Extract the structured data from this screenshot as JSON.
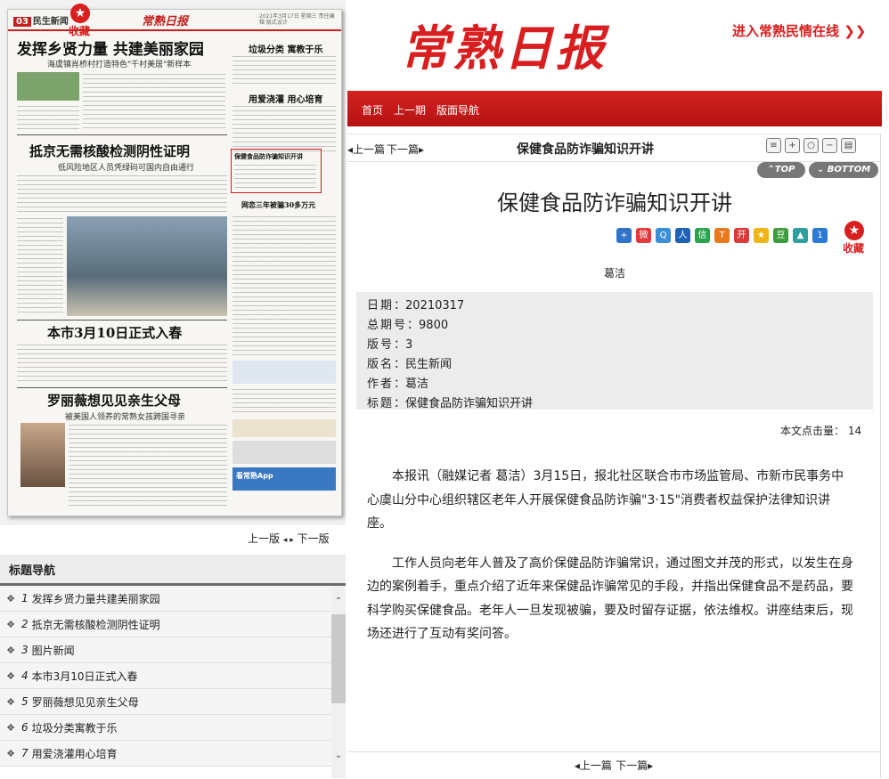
{
  "paper": {
    "section_no": "03",
    "section_name": "民生新闻",
    "logo": "常熟日报",
    "date_line": "2021年3月17日 星期三 责任编辑 版式设计",
    "favorite_label": "收藏",
    "headlines": {
      "h1": "发挥乡贤力量 共建美丽家园",
      "h1_sub": "海虞镇肖桥村打造特色\"千村美居\"新样本",
      "h2": "抵京无需核酸检测阴性证明",
      "h2_sub": "低风险地区人员凭绿码可国内自由通行",
      "h3": "本市3月10日正式入春",
      "h4": "罗丽薇想见见亲生父母",
      "h4_sub": "被美国人领养的常熟女孩跨国寻亲",
      "r1": "垃圾分类 寓教于乐",
      "r2": "用爱浇灌 用心培育",
      "r3": "保健食品防诈骗知识开讲",
      "r4": "网恋三年被骗30多万元",
      "r5": "看常熟App"
    }
  },
  "page_nav": {
    "prev": "上一版",
    "next": "下一版"
  },
  "title_nav": {
    "header": "标题导航",
    "items": [
      {
        "num": "1",
        "label": "发挥乡贤力量共建美丽家园"
      },
      {
        "num": "2",
        "label": "抵京无需核酸检测阴性证明"
      },
      {
        "num": "3",
        "label": "图片新闻"
      },
      {
        "num": "4",
        "label": "本市3月10日正式入春"
      },
      {
        "num": "5",
        "label": "罗丽薇想见见亲生父母"
      },
      {
        "num": "6",
        "label": "垃圾分类寓教于乐"
      },
      {
        "num": "7",
        "label": "用爱浇灌用心培育"
      }
    ]
  },
  "masthead": {
    "logo": "常熟日报",
    "link": "进入常熟民情在线 ❯❯"
  },
  "nav": {
    "home": "首页",
    "prev_issue": "上一期",
    "layout_nav": "版面导航"
  },
  "toolbar": {
    "prev": "◂上一篇",
    "next": "下一篇▸",
    "title": "保健食品防诈骗知识开讲",
    "top": "⌃TOP",
    "bottom": "⌄ BOTTOM"
  },
  "article": {
    "title": "保健食品防诈骗知识开讲",
    "author": "葛洁",
    "favorite_label": "收藏",
    "meta": [
      {
        "key": "日期",
        "value": "20210317"
      },
      {
        "key": "总期号",
        "value": "9800"
      },
      {
        "key": "版号",
        "value": "3"
      },
      {
        "key": "版名",
        "value": "民生新闻"
      },
      {
        "key": "作者",
        "value": "葛洁"
      },
      {
        "key": "标题",
        "value": "保健食品防诈骗知识开讲"
      }
    ],
    "hits_label": "本文点击量：",
    "hits": "14",
    "paragraphs": [
      "本报讯（融媒记者 葛洁）3月15日，报北社区联合市市场监管局、市新市民事务中心虞山分中心组织辖区老年人开展保健食品防诈骗\"3·15\"消费者权益保护法律知识讲座。",
      "工作人员向老年人普及了高价保健品防诈骗常识，通过图文并茂的形式，以发生在身边的案例着手，重点介绍了近年来保健品诈骗常见的手段，并指出保健食品不是药品，要科学购买保健食品。老年人一旦发现被骗，要及时留存证据，依法维权。讲座结束后，现场还进行了互动有奖问答。"
    ]
  },
  "share_colors": [
    "#2f74c9",
    "#e23b3b",
    "#3a8fd9",
    "#1f62b5",
    "#2aa24a",
    "#e87a1d",
    "#d93a3a",
    "#f0b419",
    "#3c9b3c",
    "#2f9e9e",
    "#2b7ad6"
  ],
  "brand_red": "#d81e1e"
}
